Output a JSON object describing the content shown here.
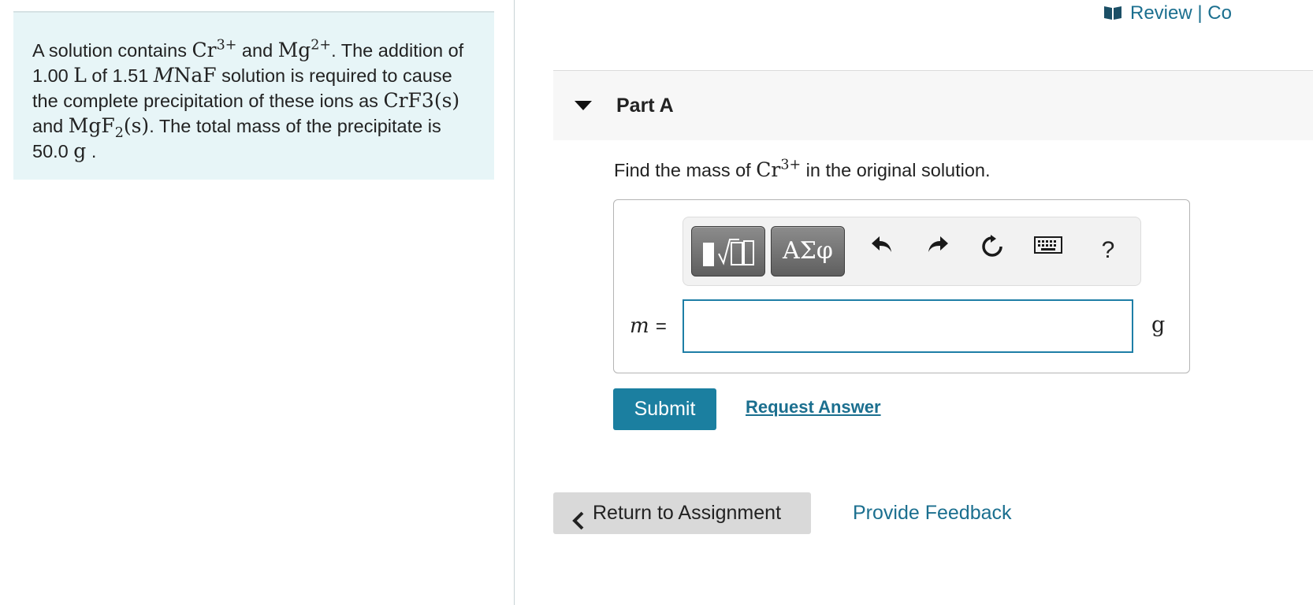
{
  "problem": {
    "t1": "A solution contains ",
    "ion1_base": "Cr",
    "ion1_charge": "3+",
    "t2": " and ",
    "ion2_base": "Mg",
    "ion2_charge": "2+",
    "t3": ". The addition of 1.00 ",
    "unit_L": "L",
    "t4": " of 1.51 ",
    "unit_M": "M",
    "salt": "NaF",
    "t5": " solution is required to cause the complete precipitation of these ions as ",
    "p1_base": "CrF",
    "p1_sub": "3",
    "p1_state": "(s)",
    "t6": " and ",
    "p2_base": "MgF",
    "p2_sub": "2",
    "p2_state": "(s)",
    "t7": ". The total mass of the precipitate is 50.0 ",
    "unit_g": "g",
    "t8": " ."
  },
  "header": {
    "review_label": "Review | Co"
  },
  "part": {
    "title": "Part A"
  },
  "question": {
    "q1": "Find the mass of ",
    "ion_base": "Cr",
    "ion_charge": "3+",
    "q2": " in the original solution."
  },
  "toolbar": {
    "symbols_label": "ΑΣφ",
    "help_label": "?"
  },
  "answer": {
    "variable": "m",
    "equals": "=",
    "value": "",
    "unit": "g"
  },
  "actions": {
    "submit_label": "Submit",
    "request_label": "Request Answer",
    "return_label": "Return to Assignment",
    "feedback_label": "Provide Feedback"
  },
  "colors": {
    "accent": "#1b7fa0",
    "link": "#1b6f8f",
    "problem_bg": "#e7f5f7"
  },
  "icons": [
    "book-icon",
    "caret-down-icon",
    "templates-icon",
    "undo-icon",
    "redo-icon",
    "reset-icon",
    "keyboard-icon",
    "help-icon",
    "chevron-left-icon"
  ]
}
